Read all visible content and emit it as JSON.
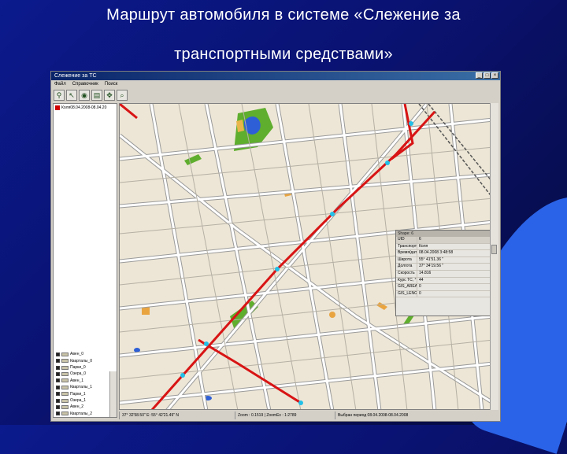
{
  "slide": {
    "title_line1": "Маршрут автомобиля в системе «Слежение за",
    "title_line2": "транспортными средствами»"
  },
  "window": {
    "title": "Слежение за ТС",
    "menu": [
      "Файл",
      "Справочник",
      "Поиск"
    ],
    "toolbar_icons": [
      "pin-icon",
      "pointer-icon",
      "eye-icon",
      "layers-icon",
      "pan-icon",
      "zoom-icon"
    ]
  },
  "layer_panel": {
    "top_item": "Коля08.04.2008-08.04.20",
    "legend": [
      "Авен_0",
      "Кварталы_0",
      "Парки_0",
      "Озера_0",
      "Авен_1",
      "Кварталы_1",
      "Парки_1",
      "Озера_1",
      "Авен_2",
      "Кварталы_2"
    ]
  },
  "shape_window": {
    "title": "Shape: 6",
    "header": {
      "name": "UID",
      "value": "6"
    },
    "rows": [
      {
        "name": "Транспорт",
        "value": "Коля"
      },
      {
        "name": "Время/дата",
        "value": "08.04.2008 3:48:58"
      },
      {
        "name": "Широта",
        "value": "55° 41'51.36 \""
      },
      {
        "name": "Долгота",
        "value": "37° 34'19.56 \""
      },
      {
        "name": "Скорость",
        "value": "14.816"
      },
      {
        "name": "Курс ТС, °",
        "value": "44"
      },
      {
        "name": "GIS_AREA",
        "value": "0"
      },
      {
        "name": "GIS_LENG",
        "value": "0"
      }
    ]
  },
  "status_bar": {
    "coords": "37° 32'58.50\" E: 55° 42'21.49\" N",
    "zoom": "Zoom : 0.1519 | ZoomEx : 1:2789",
    "period": "Выбран период 08.04.2008-08.04.2008"
  },
  "colors": {
    "route": "#d81414",
    "road": "#ffffff",
    "road_edge": "#9a9a9a",
    "land": "#ede6d6",
    "park": "#5fae2e",
    "water": "#2e5fd6",
    "marker": "#22c0e8",
    "building": "#e9a440"
  }
}
